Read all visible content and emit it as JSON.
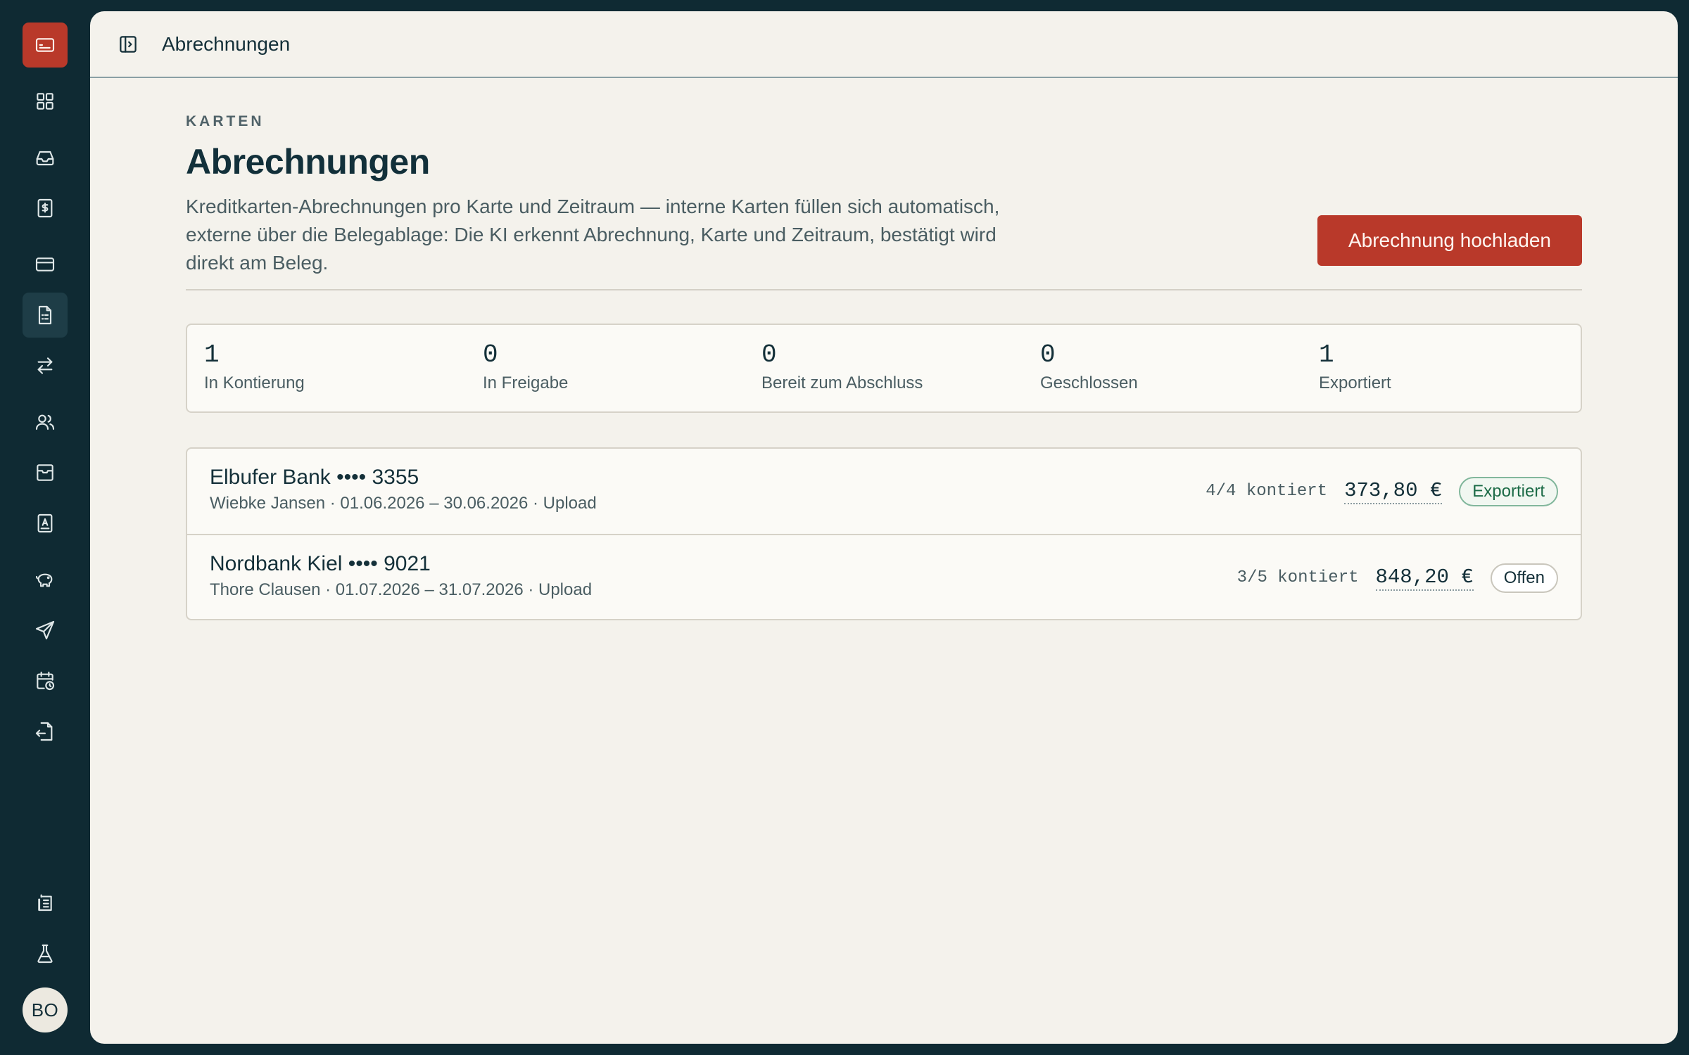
{
  "sidebar": {
    "items": [
      {
        "icon": "credit-card-brand-icon"
      },
      {
        "icon": "dashboard-grid-icon"
      },
      {
        "icon": "inbox-icon"
      },
      {
        "icon": "dollar-document-icon"
      },
      {
        "icon": "credit-card-icon"
      },
      {
        "icon": "statement-document-icon",
        "active": true
      },
      {
        "icon": "transfer-arrows-icon"
      },
      {
        "icon": "users-icon"
      },
      {
        "icon": "archive-box-icon"
      },
      {
        "icon": "contact-book-icon"
      },
      {
        "icon": "piggy-bank-icon"
      },
      {
        "icon": "send-icon"
      },
      {
        "icon": "calendar-clock-icon"
      },
      {
        "icon": "file-export-icon"
      },
      {
        "icon": "building-receipts-icon"
      },
      {
        "icon": "flask-icon"
      }
    ],
    "avatar_initials": "BO"
  },
  "topbar": {
    "breadcrumb": "Abrechnungen"
  },
  "header": {
    "eyebrow": "KARTEN",
    "title": "Abrechnungen",
    "description": "Kreditkarten-Abrechnungen pro Karte und Zeitraum — interne Karten füllen sich automatisch, externe über die Belegablage: Die KI erkennt Abrechnung, Karte und Zeitraum, bestätigt wird direkt am Beleg.",
    "upload_button": "Abrechnung hochladen"
  },
  "stats": [
    {
      "value": "1",
      "label": "In Kontierung"
    },
    {
      "value": "0",
      "label": "In Freigabe"
    },
    {
      "value": "0",
      "label": "Bereit zum Abschluss"
    },
    {
      "value": "0",
      "label": "Geschlossen"
    },
    {
      "value": "1",
      "label": "Exportiert"
    }
  ],
  "statements": [
    {
      "name": "Elbufer Bank •••• 3355",
      "meta": "Wiebke Jansen · 01.06.2026 – 30.06.2026 · Upload",
      "progress": "4/4 kontiert",
      "amount": "373,80 €",
      "status": "Exportiert"
    },
    {
      "name": "Nordbank Kiel •••• 9021",
      "meta": "Thore Clausen · 01.07.2026 – 31.07.2026 · Upload",
      "progress": "3/5 kontiert",
      "amount": "848,20 €",
      "status": "Offen"
    }
  ],
  "colors": {
    "sidebar_bg": "#0f2a33",
    "panel_bg": "#f4f2ec",
    "accent": "#b9392a",
    "exported_green": "#1c6b47"
  }
}
